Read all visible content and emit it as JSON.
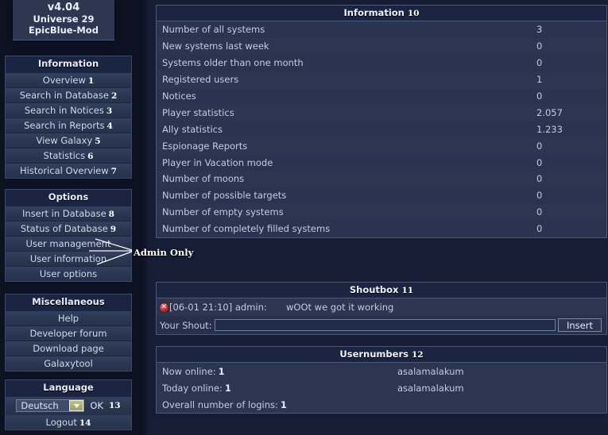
{
  "header": {
    "version": "v4.04",
    "universe": "Universe 29",
    "mod": "EpicBlue-Mod"
  },
  "sidebar": {
    "information": {
      "title": "Information",
      "items": [
        {
          "label": "Overview",
          "key": "1"
        },
        {
          "label": "Search in Database",
          "key": "2"
        },
        {
          "label": "Search in Notices",
          "key": "3"
        },
        {
          "label": "Search in Reports",
          "key": "4"
        },
        {
          "label": "View Galaxy",
          "key": "5"
        },
        {
          "label": "Statistics",
          "key": "6"
        },
        {
          "label": "Historical Overview",
          "key": "7"
        }
      ]
    },
    "options": {
      "title": "Options",
      "items": [
        {
          "label": "Insert in Database",
          "key": "8"
        },
        {
          "label": "Status of Database",
          "key": "9"
        },
        {
          "label": "User management",
          "key": ""
        },
        {
          "label": "User information",
          "key": ""
        },
        {
          "label": "User options",
          "key": ""
        }
      ]
    },
    "miscellaneous": {
      "title": "Miscellaneous",
      "items": [
        {
          "label": "Help",
          "key": ""
        },
        {
          "label": "Developer forum",
          "key": ""
        },
        {
          "label": "Download page",
          "key": ""
        },
        {
          "label": "Galaxytool",
          "key": ""
        }
      ]
    },
    "language": {
      "title": "Language",
      "selected": "Deutsch",
      "dropdown_icon": "chevron-down-icon",
      "ok_label": "OK",
      "key": "13",
      "logout_label": "Logout",
      "logout_key": "14"
    }
  },
  "annotation": {
    "admin_only": "Admin Only"
  },
  "information_panel": {
    "title": "Information",
    "key": "10",
    "rows": [
      {
        "label": "Number of all systems",
        "value": "3"
      },
      {
        "label": "New systems last week",
        "value": "0"
      },
      {
        "label": "Systems older than one month",
        "value": "0"
      },
      {
        "label": "Registered users",
        "value": "1"
      },
      {
        "label": "Notices",
        "value": "0"
      },
      {
        "label": "Player statistics",
        "value": "2.057"
      },
      {
        "label": "Ally statistics",
        "value": "1.233"
      },
      {
        "label": "Espionage Reports",
        "value": "0"
      },
      {
        "label": "Player in Vacation mode",
        "value": "0"
      },
      {
        "label": "Number of moons",
        "value": "0"
      },
      {
        "label": "Number of possible targets",
        "value": "0"
      },
      {
        "label": "Number of empty systems",
        "value": "0"
      },
      {
        "label": "Number of completely filled systems",
        "value": "0"
      }
    ]
  },
  "shoutbox": {
    "title": "Shoutbox",
    "key": "11",
    "delete_icon": "delete-x-icon",
    "messages": [
      {
        "stamp": "[06-01 21:10] admin:",
        "text": "wOOt we got it working"
      }
    ],
    "input_label": "Your Shout:",
    "input_value": "",
    "input_placeholder": "",
    "submit_label": "Insert"
  },
  "usernumbers": {
    "title": "Usernumbers",
    "key": "12",
    "rows": [
      {
        "label": "Now online:",
        "count": "1",
        "user": "asalamalakum"
      },
      {
        "label": "Today online:",
        "count": "1",
        "user": "asalamalakum"
      },
      {
        "label": "Overall number of logins:",
        "count": "1",
        "user": ""
      }
    ]
  },
  "colors": {
    "background": "#13192e",
    "panel": "#222c46",
    "panel_header": "#1b2440",
    "border": "#4a5878",
    "text": "#c3ccdf",
    "accent_green": "#9ba067",
    "delete_red": "#b3211c"
  }
}
